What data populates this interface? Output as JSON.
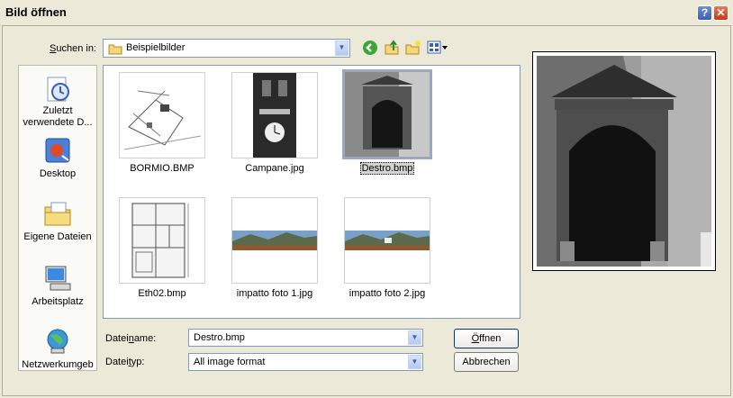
{
  "window": {
    "title": "Bild öffnen",
    "help_label": "?",
    "close_label": "✕"
  },
  "look_in": {
    "label_pre": "",
    "label_u": "S",
    "label_post": "uchen in:",
    "value": "Beispielbilder"
  },
  "places": [
    {
      "label": "Zuletzt verwendete D...",
      "icon": "recent-icon"
    },
    {
      "label": "Desktop",
      "icon": "desktop-icon"
    },
    {
      "label": "Eigene Dateien",
      "icon": "my-documents-icon"
    },
    {
      "label": "Arbeitsplatz",
      "icon": "my-computer-icon"
    },
    {
      "label": "Netzwerkumgeb",
      "icon": "network-icon"
    }
  ],
  "files": [
    {
      "name": "BORMIO.BMP"
    },
    {
      "name": "Campane.jpg"
    },
    {
      "name": "Destro.bmp"
    },
    {
      "name": "Eth02.bmp"
    },
    {
      "name": "impatto foto 1.jpg"
    },
    {
      "name": "impatto foto 2.jpg"
    }
  ],
  "filename": {
    "label_pre": "Datei",
    "label_u": "n",
    "label_post": "ame:",
    "value": "Destro.bmp"
  },
  "filetype": {
    "label_pre": "Datei",
    "label_u": "t",
    "label_post": "yp:",
    "value": "All image format"
  },
  "buttons": {
    "open_u": "Ö",
    "open_rest": "ffnen",
    "cancel": "Abbrechen"
  },
  "colors": {
    "accent": "#003c74",
    "selection": "#d3d3d3"
  }
}
